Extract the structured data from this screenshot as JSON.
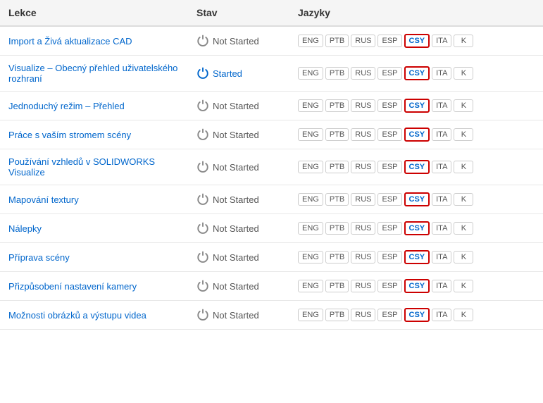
{
  "table": {
    "headers": [
      "Lekce",
      "Stav",
      "Jazyky"
    ],
    "rows": [
      {
        "id": 1,
        "lesson": "Import a Živá aktualizace CAD",
        "status": "Not Started",
        "is_started": false,
        "langs": [
          "ENG",
          "PTB",
          "RUS",
          "ESP",
          "CSY",
          "ITA",
          "K"
        ],
        "csy_highlighted": true
      },
      {
        "id": 2,
        "lesson": "Visualize – Obecný přehled uživatelského rozhraní",
        "status": "Started",
        "is_started": true,
        "langs": [
          "ENG",
          "PTB",
          "RUS",
          "ESP",
          "CSY",
          "ITA",
          "K"
        ],
        "csy_highlighted": true
      },
      {
        "id": 3,
        "lesson": "Jednoduchý režim – Přehled",
        "status": "Not Started",
        "is_started": false,
        "langs": [
          "ENG",
          "PTB",
          "RUS",
          "ESP",
          "CSY",
          "ITA",
          "K"
        ],
        "csy_highlighted": true
      },
      {
        "id": 4,
        "lesson": "Práce s vaším stromem scény",
        "status": "Not Started",
        "is_started": false,
        "langs": [
          "ENG",
          "PTB",
          "RUS",
          "ESP",
          "CSY",
          "ITA",
          "K"
        ],
        "csy_highlighted": true
      },
      {
        "id": 5,
        "lesson": "Používání vzhledů v SOLIDWORKS Visualize",
        "status": "Not Started",
        "is_started": false,
        "langs": [
          "ENG",
          "PTB",
          "RUS",
          "ESP",
          "CSY",
          "ITA",
          "K"
        ],
        "csy_highlighted": true
      },
      {
        "id": 6,
        "lesson": "Mapování textury",
        "status": "Not Started",
        "is_started": false,
        "langs": [
          "ENG",
          "PTB",
          "RUS",
          "ESP",
          "CSY",
          "ITA",
          "K"
        ],
        "csy_highlighted": true
      },
      {
        "id": 7,
        "lesson": "Nálepky",
        "status": "Not Started",
        "is_started": false,
        "langs": [
          "ENG",
          "PTB",
          "RUS",
          "ESP",
          "CSY",
          "ITA",
          "K"
        ],
        "csy_highlighted": true
      },
      {
        "id": 8,
        "lesson": "Příprava scény",
        "status": "Not Started",
        "is_started": false,
        "langs": [
          "ENG",
          "PTB",
          "RUS",
          "ESP",
          "CSY",
          "ITA",
          "K"
        ],
        "csy_highlighted": true
      },
      {
        "id": 9,
        "lesson": "Přizpůsobení nastavení kamery",
        "status": "Not Started",
        "is_started": false,
        "langs": [
          "ENG",
          "PTB",
          "RUS",
          "ESP",
          "CSY",
          "ITA",
          "K"
        ],
        "csy_highlighted": true
      },
      {
        "id": 10,
        "lesson": "Možnosti obrázků a výstupu videa",
        "status": "Not Started",
        "is_started": false,
        "langs": [
          "ENG",
          "PTB",
          "RUS",
          "ESP",
          "CSY",
          "ITA",
          "K"
        ],
        "csy_highlighted": true
      }
    ]
  }
}
